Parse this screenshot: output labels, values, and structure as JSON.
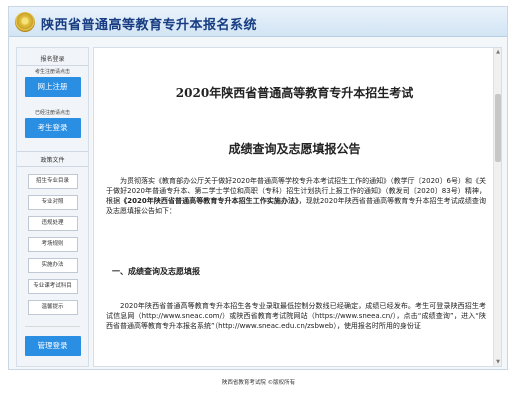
{
  "header": {
    "title": "陕西省普通高等教育专升本报名系统"
  },
  "sidebar": {
    "login_section_title": "报名登录",
    "register_note": "考生注册请点击",
    "register_button": "网上注册",
    "login_note": "已经注册请点击",
    "login_button": "考生登录",
    "policy_section_title": "政策文件",
    "policy_items": [
      "招生专业目录",
      "专业对照",
      "违规处理",
      "考场规则",
      "实施办法",
      "专业课考试科目",
      "温馨提示"
    ],
    "admin_button": "管理登录"
  },
  "content": {
    "title_line1": "2020年陕西省普通高等教育专升本招生考试",
    "title_line2": "成绩查询及志愿填报公告",
    "intro_before_bold": "为贯彻落实《教育部办公厅关于做好2020年普通高等学校专升本考试招生工作的通知》（教学厅〔2020〕6号）和《关于做好2020年普通专升本、第二学士学位和高职（专科）招生计划执行上报工作的通知》（教发司〔2020〕83号）精神，根据",
    "intro_bold": "《2020年陕西省普通高等教育专升本招生工作实施办法》",
    "intro_after_bold": "，现就2020年陕西省普通高等教育专升本招生考试成绩查询及志愿填报公告如下：",
    "section1_heading": "一、成绩查询及志愿填报",
    "section1_text": "2020年陕西省普通高等教育专升本招生各专业录取最低控制分数线已经确定，成绩已经发布。考生可登录陕西招生考试信息网（http://www.sneac.com/）或陕西省教育考试院网站（https://www.sneea.cn/），点击“成绩查询”，进入“陕西省普通高等教育专升本报名系统”（http://www.sneac.edu.cn/zsbweb），使用报名时所用的身份证"
  },
  "footer": {
    "text": "陕西省教育考试院 ©版权所有"
  }
}
